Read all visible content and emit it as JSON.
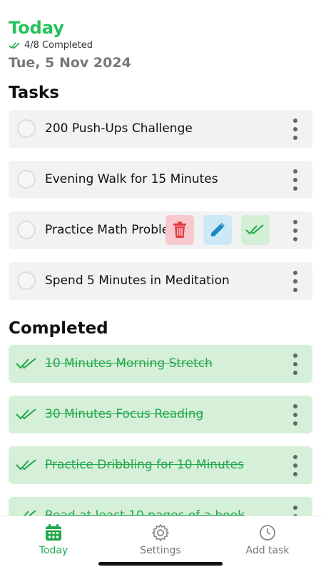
{
  "header": {
    "title": "Today",
    "progress": "4/8 Completed",
    "date": "Tue, 5 Nov 2024"
  },
  "sections": {
    "tasks_title": "Tasks",
    "completed_title": "Completed"
  },
  "tasks": [
    {
      "label": "200 Push-Ups Challenge"
    },
    {
      "label": "Evening Walk for 15 Minutes"
    },
    {
      "label": "Practice Math Proble"
    },
    {
      "label": "Spend 5 Minutes in Meditation"
    }
  ],
  "completed": [
    {
      "label": "10 Minutes Morning Stretch"
    },
    {
      "label": "30 Minutes Focus Reading"
    },
    {
      "label": "Practice Dribbling for 10 Minutes"
    },
    {
      "label": "Read at least 10 pages of a book"
    }
  ],
  "nav": {
    "today": "Today",
    "settings": "Settings",
    "add_task": "Add task"
  },
  "colors": {
    "accent": "#22c35a",
    "done_bg": "#d6efd9",
    "task_bg": "#f2f2f2",
    "delete": "#e53945",
    "edit": "#1f88c9"
  },
  "icons": {
    "progress": "double-check-icon",
    "delete": "trash-icon",
    "edit": "pencil-icon",
    "complete": "double-check-icon",
    "more": "kebab-icon",
    "today": "calendar-icon",
    "settings": "gear-icon",
    "add_task": "clock-icon"
  }
}
